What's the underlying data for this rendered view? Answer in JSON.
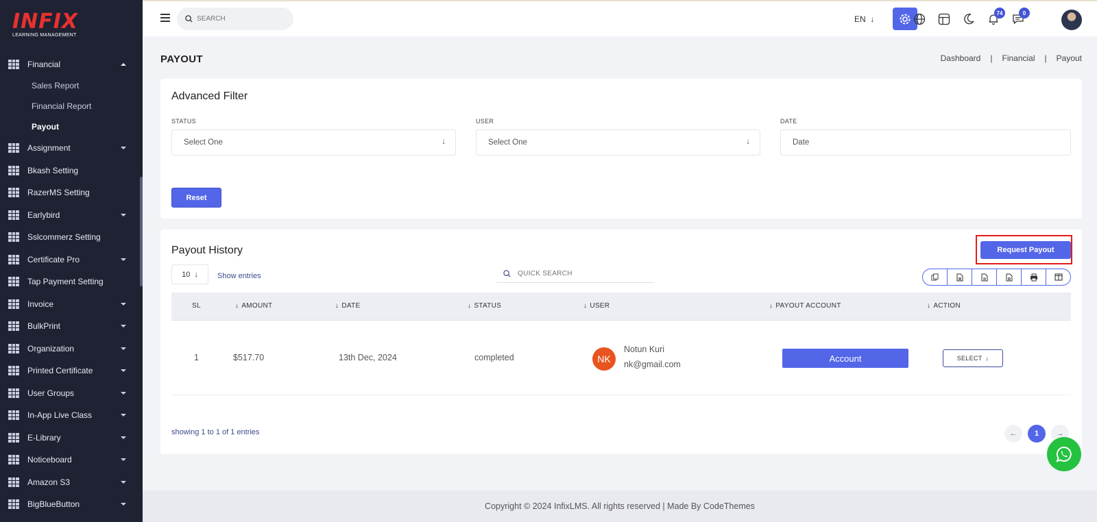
{
  "brand": {
    "logo_text": "INFIX",
    "logo_sub": "LEARNING MANAGEMENT",
    "color": "#e8312f"
  },
  "colors": {
    "accent": "#5366e8",
    "sidebar_bg": "#1e2233",
    "avatar_nk": "#e8541f",
    "whatsapp": "#25c23f",
    "highlight": "#e01c1c"
  },
  "sidebar": {
    "open_section": {
      "label": "Financial",
      "icon": "grid-icon"
    },
    "sub_items": [
      {
        "label": "Sales Report"
      },
      {
        "label": "Financial Report"
      },
      {
        "label": "Payout"
      }
    ],
    "items": [
      {
        "label": "Assignment",
        "has_caret": true
      },
      {
        "label": "Bkash Setting",
        "has_caret": false
      },
      {
        "label": "RazerMS Setting",
        "has_caret": false
      },
      {
        "label": "Earlybird",
        "has_caret": true
      },
      {
        "label": "Sslcommerz Setting",
        "has_caret": false
      },
      {
        "label": "Certificate Pro",
        "has_caret": true
      },
      {
        "label": "Tap Payment Setting",
        "has_caret": false
      },
      {
        "label": "Invoice",
        "has_caret": true
      },
      {
        "label": "BulkPrint",
        "has_caret": true
      },
      {
        "label": "Organization",
        "has_caret": true
      },
      {
        "label": "Printed Certificate",
        "has_caret": true
      },
      {
        "label": "User Groups",
        "has_caret": true
      },
      {
        "label": "In-App Live Class",
        "has_caret": true
      },
      {
        "label": "E-Library",
        "has_caret": true
      },
      {
        "label": "Noticeboard",
        "has_caret": true
      },
      {
        "label": "Amazon S3",
        "has_caret": true
      },
      {
        "label": "BigBlueButton",
        "has_caret": true
      }
    ]
  },
  "topbar": {
    "search_placeholder": "SEARCH",
    "lang": "EN",
    "notifications_count": "74",
    "messages_count": "0"
  },
  "page": {
    "title": "PAYOUT",
    "breadcrumb": [
      "Dashboard",
      "Financial",
      "Payout"
    ]
  },
  "filter": {
    "title": "Advanced Filter",
    "status_label": "STATUS",
    "status_value": "Select One",
    "user_label": "USER",
    "user_value": "Select One",
    "date_label": "DATE",
    "date_placeholder": "Date",
    "reset_label": "Reset"
  },
  "history": {
    "title": "Payout History",
    "request_label": "Request Payout",
    "entries_value": "10",
    "show_entries": "Show entries",
    "quick_search_placeholder": "QUICK SEARCH",
    "columns": [
      "SL",
      "AMOUNT",
      "DATE",
      "STATUS",
      "USER",
      "PAYOUT ACCOUNT",
      "ACTION"
    ],
    "rows": [
      {
        "sl": "1",
        "amount": "$517.70",
        "date": "13th Dec, 2024",
        "status": "completed",
        "initials": "NK",
        "user_name": "Notun Kuri",
        "user_email": "nk@gmail.com",
        "account_label": "Account",
        "action_label": "SELECT"
      }
    ],
    "showing": "showing 1 to 1 of 1 entries",
    "current_page": "1"
  },
  "footer": {
    "text": "Copyright © 2024 InfixLMS. All rights reserved | Made By CodeThemes"
  }
}
